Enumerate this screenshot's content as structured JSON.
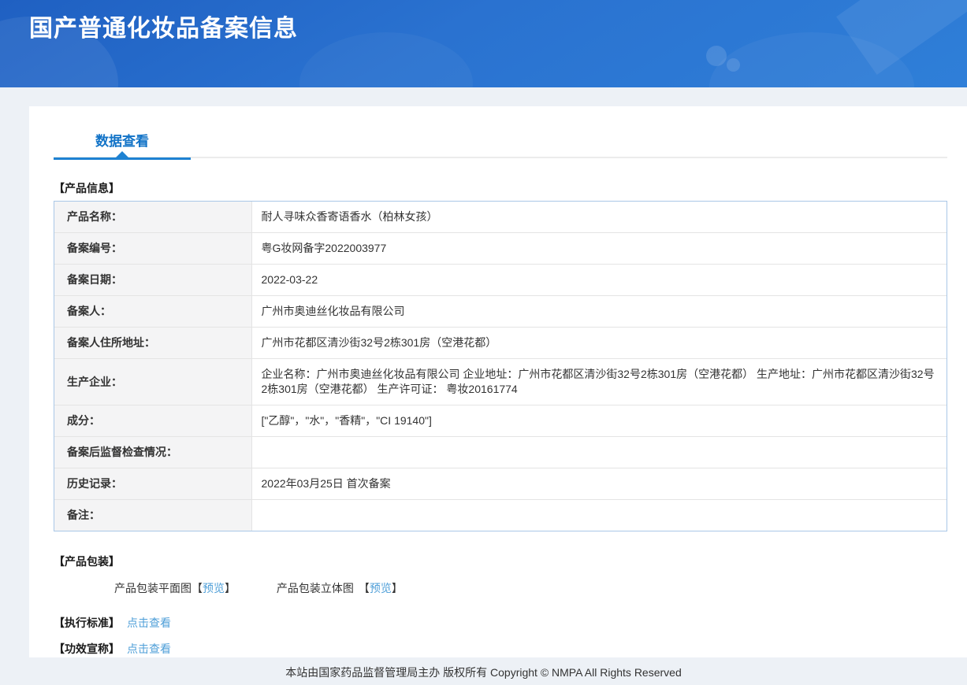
{
  "header": {
    "title": "国产普通化妆品备案信息"
  },
  "tabs": {
    "data_view": "数据查看"
  },
  "product_info": {
    "section_title": "【产品信息】",
    "rows": [
      {
        "label": "产品名称：",
        "value": "耐人寻味众香寄语香水（柏林女孩）"
      },
      {
        "label": "备案编号：",
        "value": "粤G妆网备字2022003977"
      },
      {
        "label": "备案日期：",
        "value": "2022-03-22"
      },
      {
        "label": "备案人：",
        "value": "广州市奥迪丝化妆品有限公司"
      },
      {
        "label": "备案人住所地址：",
        "value": "广州市花都区清沙街32号2栋301房（空港花都）"
      },
      {
        "label": "生产企业：",
        "value": "企业名称：广州市奥迪丝化妆品有限公司 企业地址：广州市花都区清沙街32号2栋301房（空港花都） 生产地址：广州市花都区清沙街32号2栋301房（空港花都） 生产许可证： 粤妆20161774"
      },
      {
        "label": "成分：",
        "value": "[\"乙醇\"，\"水\"，\"香精\"，\"CI 19140\"]"
      },
      {
        "label": "备案后监督检查情况：",
        "value": ""
      },
      {
        "label": "历史记录：",
        "value": "2022年03月25日 首次备案"
      },
      {
        "label": "备注：",
        "value": ""
      }
    ]
  },
  "packaging": {
    "section_title": "【产品包装】",
    "items": [
      {
        "label": "产品包装平面图",
        "bracket_open": "【",
        "link": "预览",
        "bracket_close": "】"
      },
      {
        "label": "产品包装立体图",
        "bracket_open": "【",
        "link": "预览",
        "bracket_close": "】"
      }
    ]
  },
  "standards": {
    "label": "【执行标准】",
    "link": "点击查看"
  },
  "efficacy": {
    "label": "【功效宣称】",
    "link": "点击查看"
  },
  "footer": {
    "text": "本站由国家药品监督管理局主办 版权所有 Copyright © NMPA All Rights Reserved"
  },
  "colors": {
    "header_blue_start": "#1f60c2",
    "header_blue_end": "#2f7fd8",
    "tab_blue": "#1273c7",
    "tab_underline": "#1e82d2",
    "link_blue": "#4f9fd8",
    "table_outer_border": "#a9c7e7",
    "label_cell_bg": "#f4f4f5",
    "page_bg": "#edf1f6"
  }
}
